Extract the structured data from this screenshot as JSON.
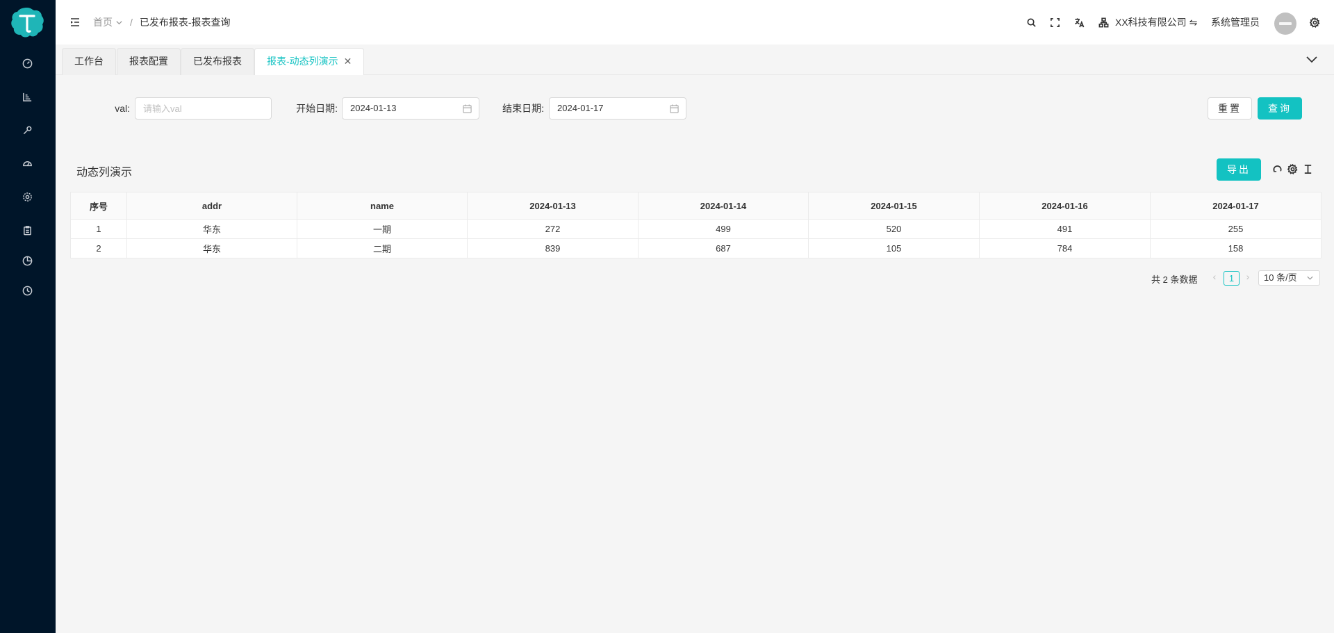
{
  "header": {
    "breadcrumb_home": "首页",
    "breadcrumb_sep": "/",
    "breadcrumb_current": "已发布报表-报表查询",
    "company": "XX科技有限公司 ⇋",
    "username": "系统管理员"
  },
  "tabs": [
    {
      "label": "工作台"
    },
    {
      "label": "报表配置"
    },
    {
      "label": "已发布报表"
    },
    {
      "label": "报表-动态列演示",
      "close": "✕"
    }
  ],
  "form": {
    "val_label": "val:",
    "val_placeholder": "请输入val",
    "start_label": "开始日期:",
    "start_value": "2024-01-13",
    "end_label": "结束日期:",
    "end_value": "2024-01-17",
    "reset_label": "重置",
    "query_label": "查询"
  },
  "table": {
    "title": "动态列演示",
    "export_label": "导出",
    "columns": [
      "序号",
      "addr",
      "name",
      "2024-01-13",
      "2024-01-14",
      "2024-01-15",
      "2024-01-16",
      "2024-01-17"
    ],
    "rows": [
      [
        "1",
        "华东",
        "一期",
        "272",
        "499",
        "520",
        "491",
        "255"
      ],
      [
        "2",
        "华东",
        "二期",
        "839",
        "687",
        "105",
        "784",
        "158"
      ]
    ]
  },
  "pagination": {
    "total_text": "共 2 条数据",
    "prev": "‹",
    "current_page": "1",
    "next": "›",
    "page_size": "10 条/页"
  },
  "colors": {
    "sidebar_bg": "#001529",
    "accent": "#13c2c2"
  },
  "icons": {
    "sidebar": [
      "dashboard-icon",
      "chart-icon",
      "tool-icon",
      "gauge-icon",
      "settings-icon",
      "clipboard-icon",
      "pie-icon",
      "clock-icon"
    ],
    "header": [
      "search-icon",
      "fullscreen-icon",
      "translate-icon",
      "org-icon",
      "gear-icon"
    ]
  }
}
